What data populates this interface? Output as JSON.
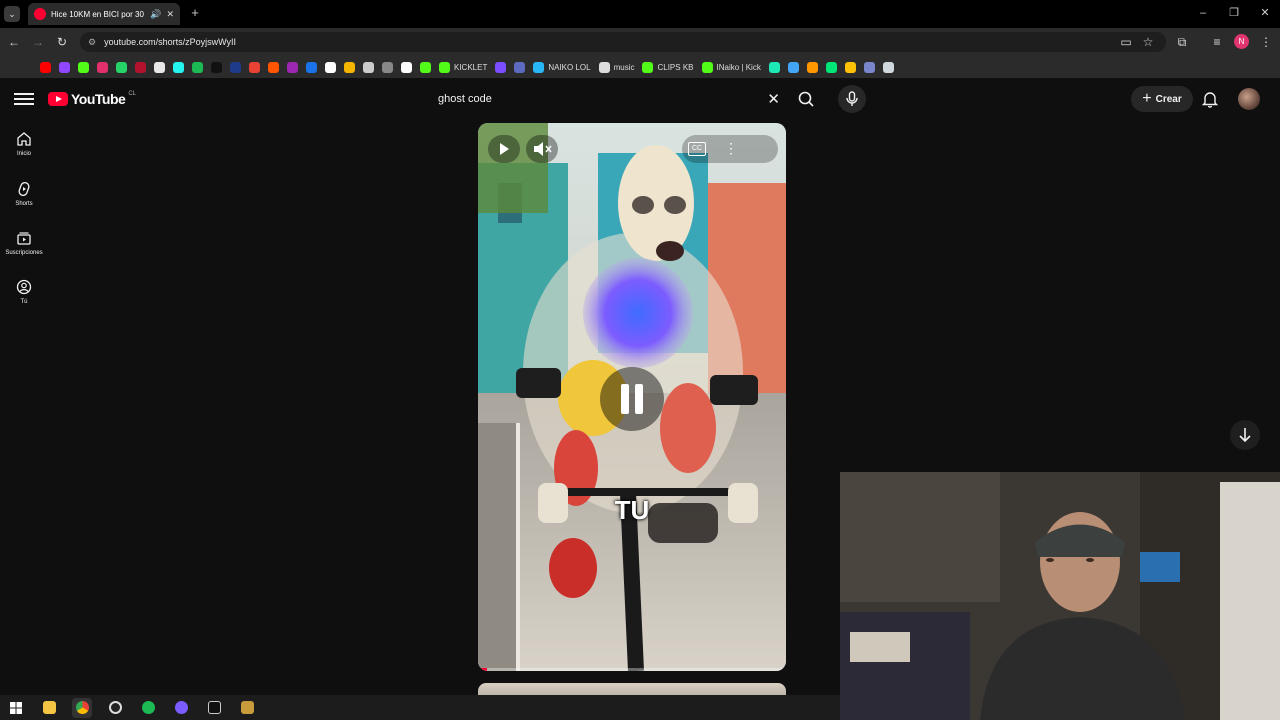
{
  "browser": {
    "tab_title": "Hice 10KM en BICI por 30 D",
    "url": "youtube.com/shorts/zPoyjswWyII"
  },
  "bookmarks": [
    {
      "label": "",
      "color": "#ff0000"
    },
    {
      "label": "",
      "color": "#9146ff"
    },
    {
      "label": "",
      "color": "#53fc18"
    },
    {
      "label": "",
      "color": "#e1306c"
    },
    {
      "label": "",
      "color": "#25d366"
    },
    {
      "label": "",
      "color": "#b3122e"
    },
    {
      "label": "",
      "color": "#e8e8e8"
    },
    {
      "label": "",
      "color": "#25f4ee"
    },
    {
      "label": "",
      "color": "#1db954"
    },
    {
      "label": "",
      "color": "#111111"
    },
    {
      "label": "",
      "color": "#1e3a8a"
    },
    {
      "label": "",
      "color": "#ea4335"
    },
    {
      "label": "",
      "color": "#ff5500"
    },
    {
      "label": "",
      "color": "#9c27b0"
    },
    {
      "label": "",
      "color": "#1a73e8"
    },
    {
      "label": "",
      "color": "#ffffff"
    },
    {
      "label": "",
      "color": "#f4b400"
    },
    {
      "label": "",
      "color": "#cccccc"
    },
    {
      "label": "",
      "color": "#888888"
    },
    {
      "label": "",
      "color": "#ffffff"
    },
    {
      "label": "",
      "color": "#53fc18"
    },
    {
      "label": "KICKLET",
      "color": "#53fc18"
    },
    {
      "label": "",
      "color": "#7c4dff"
    },
    {
      "label": "",
      "color": "#5c6bc0"
    },
    {
      "label": "NAIKO LOL",
      "color": "#29b6f6"
    },
    {
      "label": "music",
      "color": "#dddddd"
    },
    {
      "label": "CLIPS KB",
      "color": "#53fc18"
    },
    {
      "label": "INaiko | Kick",
      "color": "#53fc18"
    },
    {
      "label": "",
      "color": "#1de9b6"
    },
    {
      "label": "",
      "color": "#42a5f5"
    },
    {
      "label": "",
      "color": "#ff9800"
    },
    {
      "label": "",
      "color": "#00e676"
    },
    {
      "label": "",
      "color": "#ffc107"
    },
    {
      "label": "",
      "color": "#7986cb"
    },
    {
      "label": "",
      "color": "#cfd8dc"
    }
  ],
  "youtube": {
    "logo_text": "YouTube",
    "country_code": "CL",
    "search_value": "ghost code",
    "create_label": "Crear",
    "sidebar": [
      {
        "label": "Inicio",
        "icon": "home-icon"
      },
      {
        "label": "Shorts",
        "icon": "shorts-icon"
      },
      {
        "label": "Suscripciones",
        "icon": "subscriptions-icon"
      },
      {
        "label": "Tú",
        "icon": "you-icon"
      }
    ]
  },
  "video": {
    "overlay_text": "TU",
    "state": "paused",
    "muted": true
  }
}
